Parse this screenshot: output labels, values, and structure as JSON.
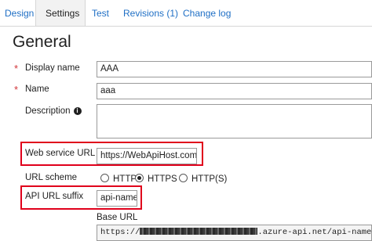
{
  "tabs": [
    "Design",
    "Settings",
    "Test",
    "Revisions (1)",
    "Change log"
  ],
  "section_title": "General",
  "fields": {
    "display_name": {
      "label": "Display name",
      "value": "AAA"
    },
    "name": {
      "label": "Name",
      "value": "aaa"
    },
    "description": {
      "label": "Description",
      "value": ""
    },
    "web_service_url": {
      "label": "Web service URL",
      "value": "https://WebApiHost.com/api"
    },
    "url_scheme": {
      "label": "URL scheme",
      "options": [
        "HTTP",
        "HTTPS",
        "HTTP(S)"
      ],
      "selected": "HTTPS"
    },
    "api_url_suffix": {
      "label": "API URL suffix",
      "value": "api-name"
    },
    "base_url": {
      "label": "Base URL",
      "prefix": "https://",
      "suffix": ".azure-api.net/api-name"
    }
  },
  "required_marker": "*",
  "info_glyph": "i",
  "colors": {
    "link": "#1f6fc5",
    "required": "#d13438",
    "highlight": "#e0001b"
  }
}
